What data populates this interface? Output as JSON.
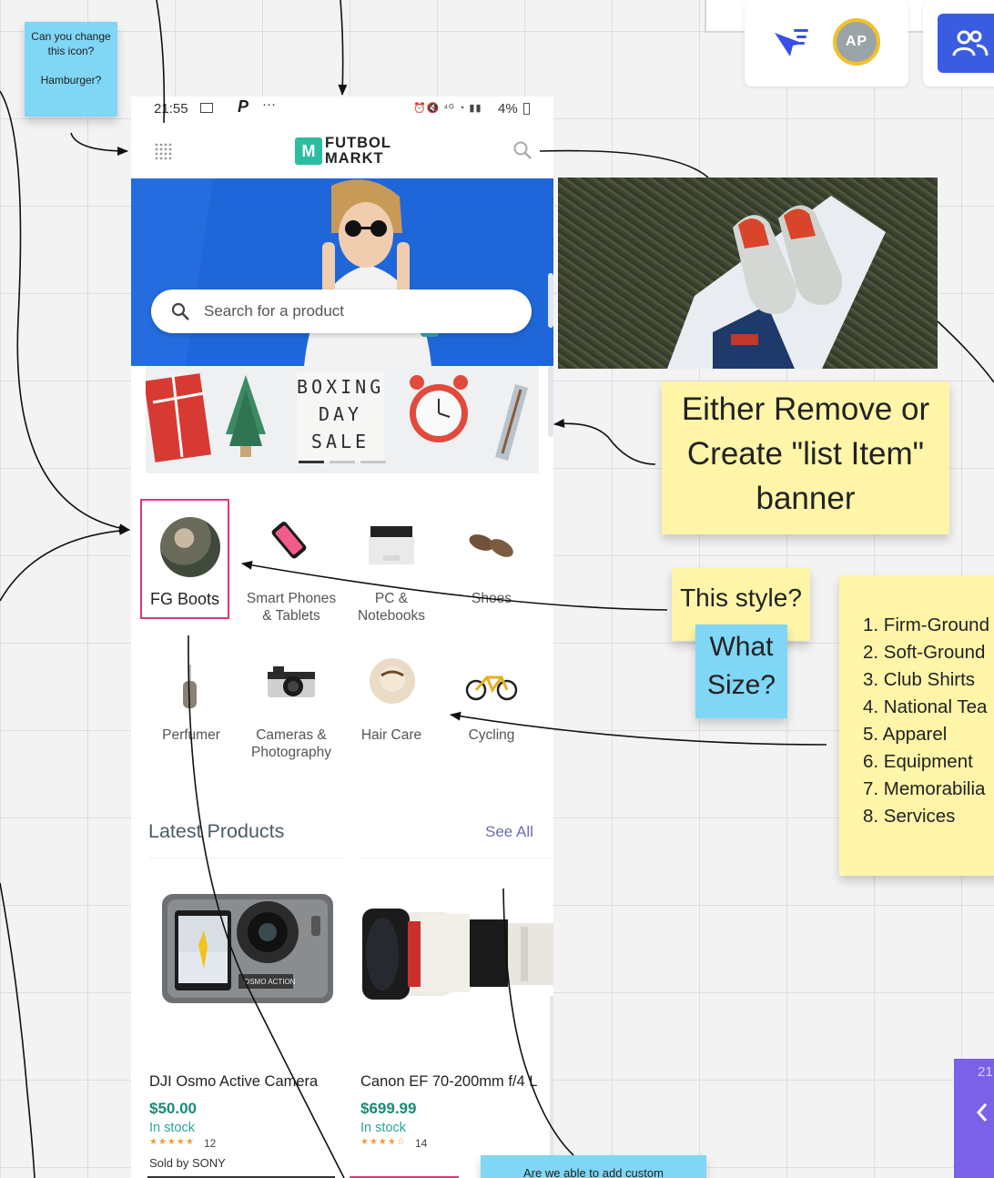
{
  "notes": {
    "icon_question": "Can you change this icon?\n\nHamburger?",
    "banner_note": "Either Remove or Create \"list Item\" banner",
    "style_note": "This style?",
    "size_note": "What Size?",
    "category_list": [
      "1. Firm-Ground",
      "2. Soft-Ground",
      "3. Club Shirts",
      "4. National Tea",
      "5. Apparel",
      "6. Equipment",
      "7. Memorabilia",
      "8. Services"
    ],
    "bottom_note": "Are we able to add custom"
  },
  "toolbar": {
    "avatar_initials": "AP",
    "side_panel_number": "21"
  },
  "phone": {
    "status": {
      "time": "21:55",
      "battery": "4%"
    },
    "brand": {
      "line1": "FUTBOL",
      "line2": "MARKT"
    },
    "search_placeholder": "Search for a product",
    "promo": {
      "line1": "BOXING",
      "line2": "DAY",
      "line3": "SALE"
    },
    "categories": [
      {
        "label": "FG Boots"
      },
      {
        "label": "Smart Phones & Tablets"
      },
      {
        "label": "PC & Notebooks"
      },
      {
        "label": "Shoes"
      },
      {
        "label": "Perfumer"
      },
      {
        "label": "Cameras & Photography"
      },
      {
        "label": "Hair Care"
      },
      {
        "label": "Cycling"
      }
    ],
    "latest": {
      "title": "Latest Products",
      "see_all": "See All"
    },
    "products": [
      {
        "name": "DJI Osmo Active Camera",
        "price": "$50.00",
        "stock": "In stock",
        "rating_count": "12",
        "seller": "Sold by SONY",
        "camera_label": "OSMO ACTION"
      },
      {
        "name": "Canon EF 70-200mm f/4 L",
        "price": "$699.99",
        "stock": "In stock",
        "rating_count": "14"
      }
    ]
  },
  "colors": {
    "brand_teal": "#2bbf9f",
    "price_teal": "#1a8a78",
    "stock_teal": "#26a69a",
    "sticky_yellow": "#fff5a8",
    "sticky_blue": "#7fd6f5",
    "highlight_pink": "#e0347e",
    "toolbar_blue": "#3a5ce0",
    "side_purple": "#7b61e8"
  },
  "icons": [
    "hamburger-grid-icon",
    "search-icon",
    "cursor-filter-icon",
    "people-icon",
    "chevron-left-icon"
  ]
}
